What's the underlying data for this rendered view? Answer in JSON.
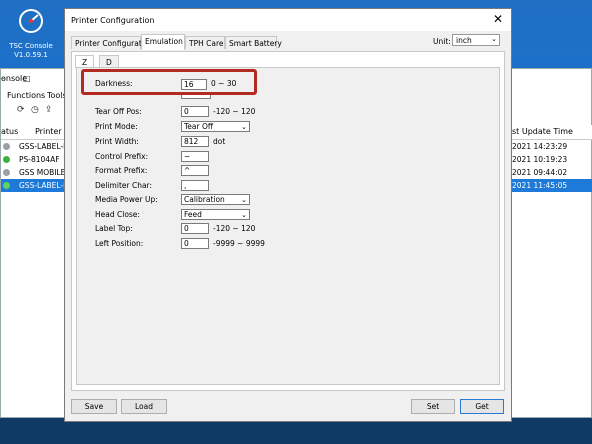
{
  "desktop": {
    "icon_label": "TSC Console V1.0.59.1"
  },
  "background_window": {
    "title": "onsole",
    "menu": [
      "Functions",
      "Tools"
    ],
    "columns": {
      "status": "atus",
      "printer": "Printer",
      "last_update": "st Update Time"
    },
    "rows": [
      {
        "printer": "GSS-LABEL-P...",
        "time": "2021 14:23:29",
        "status_color": "#9aa0a6",
        "selected": false
      },
      {
        "printer": "PS-8104AF",
        "time": "2021 10:19:23",
        "status_color": "#3cb043",
        "selected": false
      },
      {
        "printer": "GSS MOBILE P...",
        "time": "2021 09:44:02",
        "status_color": "#9aa0a6",
        "selected": false
      },
      {
        "printer": "GSS-LABEL-P...",
        "time": "2021 11:45:05",
        "status_color": "#5fd35f",
        "selected": true
      }
    ]
  },
  "dialog": {
    "title": "Printer Configuration",
    "close": "✕",
    "tabs": [
      "Printer Configuration",
      "Emulation",
      "TPH Care",
      "Smart Battery"
    ],
    "active_tab": "Emulation",
    "unit_label": "Unit:",
    "unit_value": "inch",
    "subtabs": [
      "Z",
      "D"
    ],
    "fields": {
      "darkness": {
        "label": "Darkness:",
        "value": "16",
        "range": "0 ~ 30"
      },
      "tear_off": {
        "label": "Tear Off Pos:",
        "value": "0",
        "range": "-120 ~ 120"
      },
      "print_mode": {
        "label": "Print Mode:",
        "value": "Tear Off"
      },
      "print_width": {
        "label": "Print Width:",
        "value": "812",
        "unit": "dot"
      },
      "control_prefix": {
        "label": "Control Prefix:",
        "value": "~"
      },
      "format_prefix": {
        "label": "Format Prefix:",
        "value": "^"
      },
      "delimiter": {
        "label": "Delimiter Char:",
        "value": ","
      },
      "media_power_up": {
        "label": "Media Power Up:",
        "value": "Calibration"
      },
      "head_close": {
        "label": "Head Close:",
        "value": "Feed"
      },
      "label_top": {
        "label": "Label Top:",
        "value": "0",
        "range": "-120 ~ 120"
      },
      "left_position": {
        "label": "Left Position:",
        "value": "0",
        "range": "-9999 ~ 9999"
      }
    },
    "buttons": {
      "save": "Save",
      "load": "Load",
      "set": "Set",
      "get": "Get"
    },
    "highlight_color": "#b22a22"
  }
}
